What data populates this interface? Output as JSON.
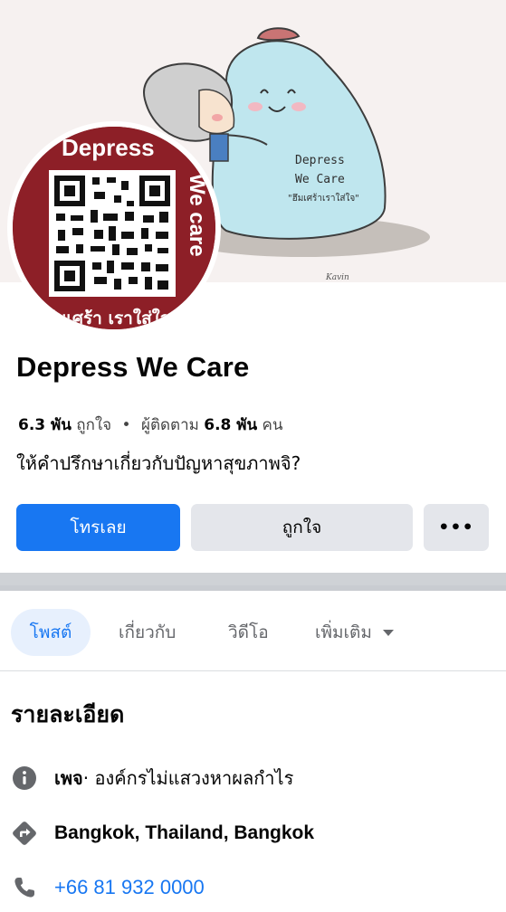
{
  "cover": {
    "artwork_text_line1": "Depress",
    "artwork_text_line2": "We Care",
    "artwork_text_line3": "\"ฮึมเศร้าเราใส่ใจ\"",
    "artist_signature": "Kavin"
  },
  "avatar": {
    "text_top": "Depress",
    "text_side": "We care",
    "text_bottom": "ซึมเศร้า เราใส่ใจ",
    "bg_color": "#8d1f27"
  },
  "profile": {
    "name": "Depress We Care",
    "likes_count": "6.3 พัน",
    "likes_label": "ถูกใจ",
    "separator": "•",
    "followers_label": "ผู้ติดตาม",
    "followers_count": "6.8 พัน",
    "followers_unit": "คน",
    "bio": "ให้คำปรึกษาเกี่ยวกับปัญหาสุขภาพจิ?"
  },
  "actions": {
    "call_label": "โทรเลย",
    "like_label": "ถูกใจ",
    "more_label": "•••",
    "accent_color": "#1877f2"
  },
  "tabs": [
    {
      "label": "โพสต์",
      "active": true
    },
    {
      "label": "เกี่ยวกับ",
      "active": false
    },
    {
      "label": "วิดีโอ",
      "active": false
    },
    {
      "label": "เพิ่มเติม",
      "active": false
    }
  ],
  "details": {
    "title": "รายละเอียด",
    "page_type_label": "เพจ",
    "page_type_value": " · องค์กรไม่แสวงหาผลกำไร",
    "location": "Bangkok, Thailand, Bangkok",
    "phone": "+66 81 932 0000",
    "icons": [
      "info-icon",
      "directions-icon",
      "phone-icon"
    ]
  }
}
